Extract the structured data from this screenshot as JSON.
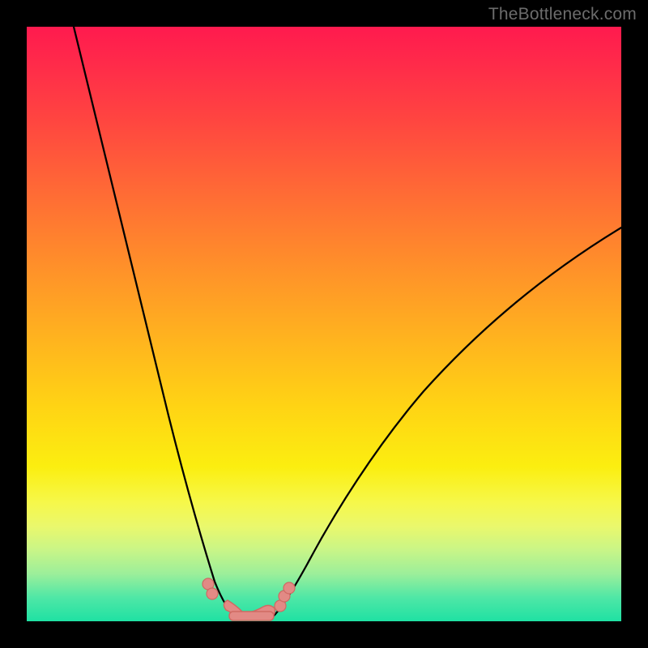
{
  "watermark": "TheBottleneck.com",
  "chart_data": {
    "type": "line",
    "title": "",
    "xlabel": "",
    "ylabel": "",
    "xlim": [
      0,
      100
    ],
    "ylim": [
      0,
      100
    ],
    "background_gradient": {
      "top": "#ff1a4e",
      "mid": "#ffd414",
      "bottom": "#1fe1a3"
    },
    "series": [
      {
        "name": "left-curve",
        "x": [
          8,
          12,
          16,
          20,
          24,
          28,
          30,
          32,
          34,
          35.5
        ],
        "values": [
          100,
          80,
          58,
          40,
          24,
          12,
          7,
          3.5,
          1.2,
          0.2
        ]
      },
      {
        "name": "right-curve",
        "x": [
          41,
          43,
          46,
          50,
          55,
          62,
          70,
          80,
          90,
          100
        ],
        "values": [
          0.2,
          1.5,
          4,
          8,
          14,
          22,
          31,
          42,
          53,
          63
        ]
      }
    ],
    "markers": {
      "dots": [
        {
          "x": 30.5,
          "y": 6.2
        },
        {
          "x": 31.2,
          "y": 4.6
        },
        {
          "x": 42.6,
          "y": 2.6
        },
        {
          "x": 43.3,
          "y": 4.2
        },
        {
          "x": 44.1,
          "y": 5.6
        }
      ],
      "flat_segment": {
        "x_start": 33.5,
        "x_end": 41.5,
        "y": 0.4
      }
    }
  }
}
